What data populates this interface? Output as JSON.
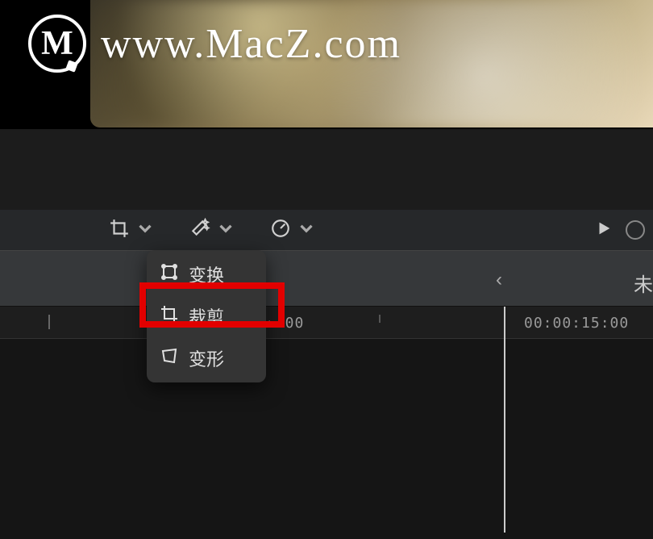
{
  "watermark": {
    "logo_letter": "M",
    "text": "www.MacZ.com"
  },
  "toolbar": {
    "transform_tool": "transform",
    "enhance_tool": "enhance",
    "retiming_tool": "retiming"
  },
  "dropdown": {
    "items": [
      {
        "label": "变换",
        "name": "transform"
      },
      {
        "label": "裁剪",
        "name": "crop"
      },
      {
        "label": "变形",
        "name": "distort"
      }
    ]
  },
  "timeline": {
    "nav_back": "‹",
    "title_suffix": "未",
    "time_partial": "›:00",
    "time_label": "00:00:15:00"
  }
}
